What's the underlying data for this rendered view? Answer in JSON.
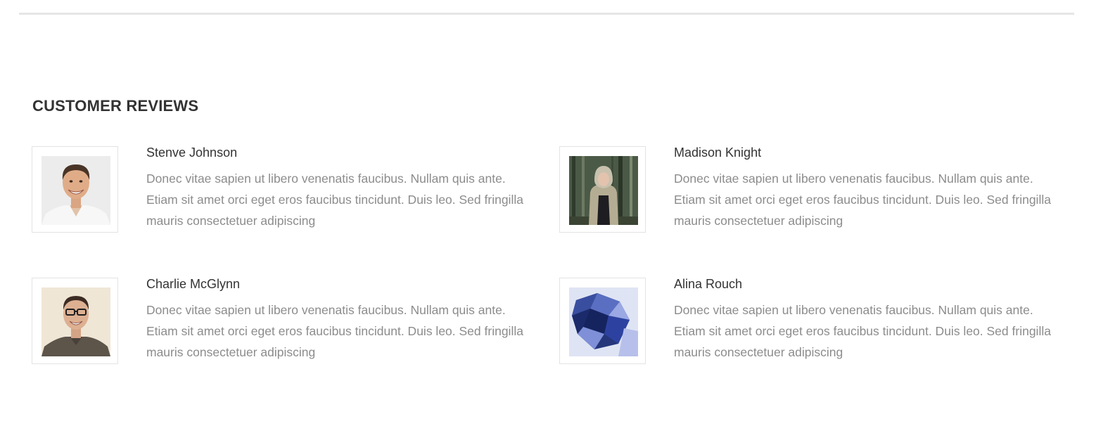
{
  "section": {
    "title": "CUSTOMER REVIEWS"
  },
  "reviews": [
    {
      "name": "Stenve Johnson",
      "avatar_icon": "man-smiling-avatar",
      "text": "Donec vitae sapien ut libero venenatis faucibus. Nullam quis ante. Etiam sit amet orci eget eros faucibus tincidunt. Duis leo. Sed fringilla mauris consectetuer adipiscing"
    },
    {
      "name": "Madison Knight",
      "avatar_icon": "woman-forest-avatar",
      "text": "Donec vitae sapien ut libero venenatis faucibus. Nullam quis ante. Etiam sit amet orci eget eros faucibus tincidunt. Duis leo. Sed fringilla mauris consectetuer adipiscing"
    },
    {
      "name": "Charlie McGlynn",
      "avatar_icon": "man-glasses-avatar",
      "text": "Donec vitae sapien ut libero venenatis faucibus. Nullam quis ante. Etiam sit amet orci eget eros faucibus tincidunt. Duis leo. Sed fringilla mauris consectetuer adipiscing"
    },
    {
      "name": "Alina Rouch",
      "avatar_icon": "blue-gem-avatar",
      "text": "Donec vitae sapien ut libero venenatis faucibus. Nullam quis ante. Etiam sit amet orci eget eros faucibus tincidunt. Duis leo. Sed fringilla mauris consectetuer adipiscing"
    }
  ],
  "colors": {
    "title": "#333333",
    "name": "#333333",
    "body_text": "#8c8c8c",
    "divider": "#e6e6e6",
    "frame_border": "#e3e3e3"
  }
}
